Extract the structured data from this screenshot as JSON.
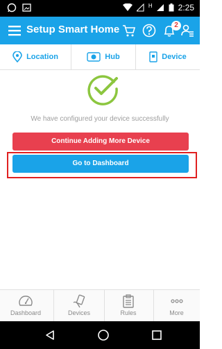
{
  "status_bar": {
    "time": "2:25",
    "sim_label": "H"
  },
  "app_bar": {
    "title": "Setup Smart Home",
    "notification_count": "2"
  },
  "tabs": [
    {
      "label": "Location",
      "icon": "location-pin-icon"
    },
    {
      "label": "Hub",
      "icon": "hub-icon"
    },
    {
      "label": "Device",
      "icon": "device-icon"
    }
  ],
  "main": {
    "success_message": "We have configured your device successfully",
    "continue_button": "Continue Adding More Device",
    "dashboard_button": "Go to Dashboard"
  },
  "bottom_nav": [
    {
      "label": "Dashboard",
      "icon": "dashboard-gauge-icon"
    },
    {
      "label": "Devices",
      "icon": "devices-hand-icon"
    },
    {
      "label": "Rules",
      "icon": "rules-clipboard-icon"
    },
    {
      "label": "More",
      "icon": "more-dots-icon"
    }
  ],
  "colors": {
    "primary": "#1aa3e8",
    "danger": "#e8404f",
    "success": "#8cc63f",
    "highlight": "#e02020"
  }
}
